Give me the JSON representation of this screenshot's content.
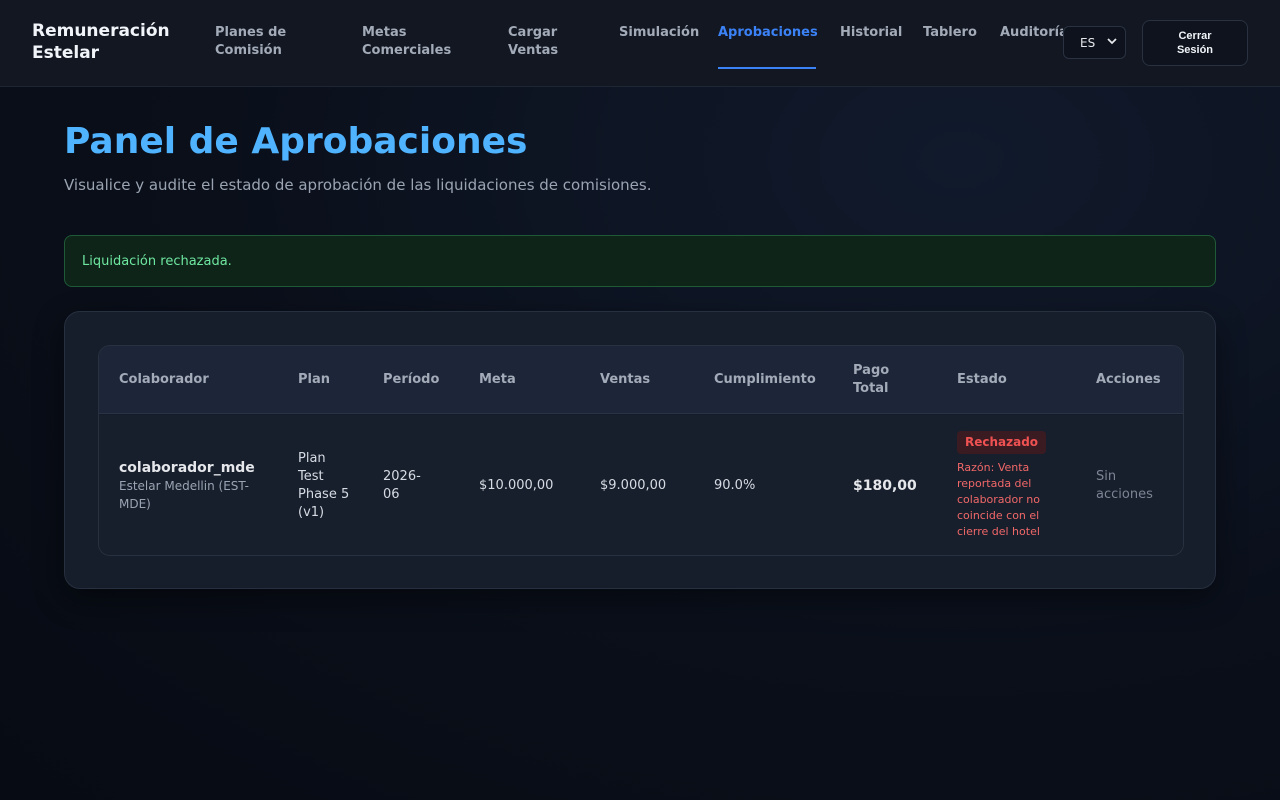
{
  "app": {
    "brand": "Remuneración Estelar"
  },
  "nav": {
    "items": [
      {
        "label": "Planes de Comisión"
      },
      {
        "label": "Metas Comerciales"
      },
      {
        "label": "Cargar Ventas"
      },
      {
        "label": "Simulación"
      },
      {
        "label": "Aprobaciones"
      },
      {
        "label": "Historial"
      },
      {
        "label": "Tablero"
      },
      {
        "label": "Auditoría"
      }
    ],
    "active": "Aprobaciones",
    "language": "ES",
    "logout_label": "Cerrar Sesión"
  },
  "page": {
    "title": "Panel de Aprobaciones",
    "subtitle": "Visualice y audite el estado de aprobación de las liquidaciones de comisiones."
  },
  "alert": {
    "message": "Liquidación rechazada."
  },
  "table": {
    "headers": {
      "collaborator": "Colaborador",
      "plan": "Plan",
      "period": "Período",
      "target": "Meta",
      "sales": "Ventas",
      "attainment": "Cumplimiento",
      "payout": "Pago Total",
      "status": "Estado",
      "actions": "Acciones"
    },
    "rows": [
      {
        "collaborator": "colaborador_mde",
        "collaborator_sub": "Estelar Medellin (EST-MDE)",
        "plan": "Plan Test Phase 5 (v1)",
        "period": "2026-06",
        "target": "$10.000,00",
        "sales": "$9.000,00",
        "attainment": "90.0%",
        "payout": "$180,00",
        "status": "Rechazado",
        "reason": "Razón: Venta reportada del colaborador no coincide con el cierre del hotel",
        "actions": "Sin acciones"
      }
    ]
  },
  "colors": {
    "accent": "#3b82f6",
    "title": "#4fb3ff",
    "success_text": "#6ee7a0",
    "danger": "#f05252"
  }
}
